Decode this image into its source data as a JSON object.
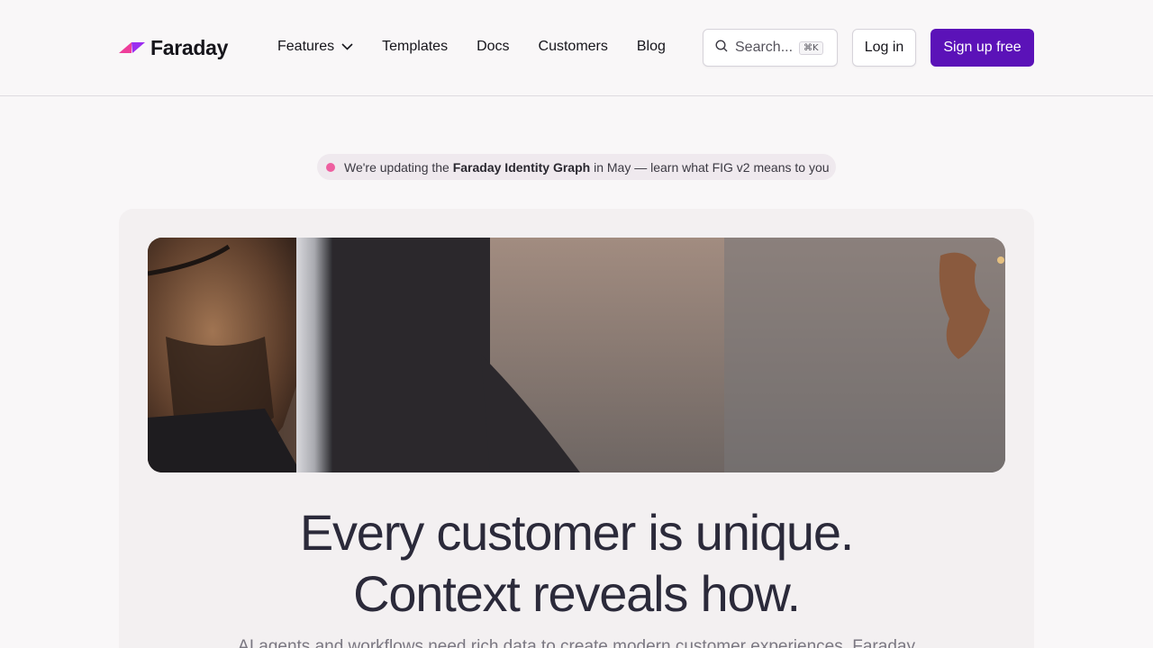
{
  "brand": {
    "name": "Faraday",
    "colors": {
      "primary": "#5b12b8",
      "logo_pink": "#ee3d9a",
      "logo_purple": "#9b2cf0",
      "dot": "#ee5fa0"
    }
  },
  "nav": {
    "items": [
      {
        "label": "Features",
        "has_dropdown": true,
        "icon": "chevron-down-icon"
      },
      {
        "label": "Templates"
      },
      {
        "label": "Docs"
      },
      {
        "label": "Customers"
      },
      {
        "label": "Blog"
      }
    ]
  },
  "search": {
    "label": "Search...",
    "shortcut": "⌘K",
    "icon": "search-icon"
  },
  "auth": {
    "login_label": "Log in",
    "signup_label": "Sign up free"
  },
  "announcement": {
    "prefix": "We're updating the ",
    "bold": "Faraday Identity Graph",
    "suffix": " in May — learn what FIG v2 means to you"
  },
  "hero": {
    "image_icon": "hero-photo",
    "headline_line1": "Every customer is unique.",
    "headline_line2": "Context reveals how.",
    "subtext": "AI agents and workflows need rich data to create modern customer experiences. Faraday"
  }
}
